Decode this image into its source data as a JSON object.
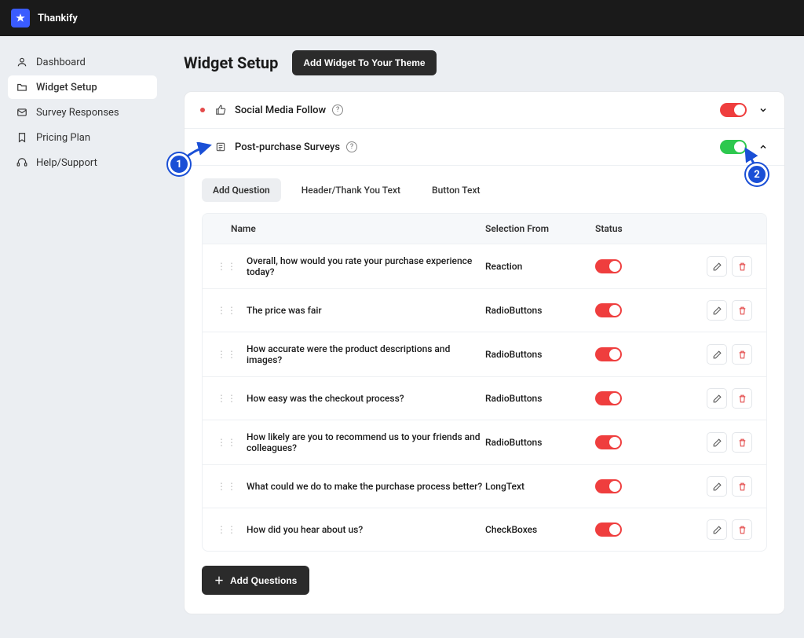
{
  "brand": "Thankify",
  "sidebar": {
    "items": [
      {
        "label": "Dashboard",
        "icon": "user"
      },
      {
        "label": "Widget Setup",
        "icon": "folder",
        "active": true
      },
      {
        "label": "Survey Responses",
        "icon": "mail"
      },
      {
        "label": "Pricing Plan",
        "icon": "bookmark"
      },
      {
        "label": "Help/Support",
        "icon": "headset"
      }
    ]
  },
  "page": {
    "title": "Widget Setup",
    "add_widget_btn": "Add Widget To Your Theme"
  },
  "sections": [
    {
      "label": "Social Media Follow",
      "enabled": "off",
      "expanded": false,
      "dot": "red"
    },
    {
      "label": "Post-purchase Surveys",
      "enabled": "on",
      "expanded": true,
      "dot": "green"
    }
  ],
  "tabs": [
    {
      "label": "Add Question",
      "active": true
    },
    {
      "label": "Header/Thank You Text",
      "active": false
    },
    {
      "label": "Button Text",
      "active": false
    }
  ],
  "table": {
    "headers": {
      "name": "Name",
      "selection": "Selection From",
      "status": "Status"
    },
    "rows": [
      {
        "name": "Overall, how would you rate your purchase experience today?",
        "selection": "Reaction"
      },
      {
        "name": "The price was fair",
        "selection": "RadioButtons"
      },
      {
        "name": "How accurate were the product descriptions and images?",
        "selection": "RadioButtons"
      },
      {
        "name": "How easy was the checkout process?",
        "selection": "RadioButtons"
      },
      {
        "name": "How likely are you to recommend us to your friends and colleagues?",
        "selection": "RadioButtons"
      },
      {
        "name": "What could we do to make the purchase process better?",
        "selection": "LongText"
      },
      {
        "name": "How did you hear about us?",
        "selection": "CheckBoxes"
      }
    ],
    "add_btn": "Add Questions"
  },
  "callouts": {
    "c1": "1",
    "c2": "2"
  }
}
